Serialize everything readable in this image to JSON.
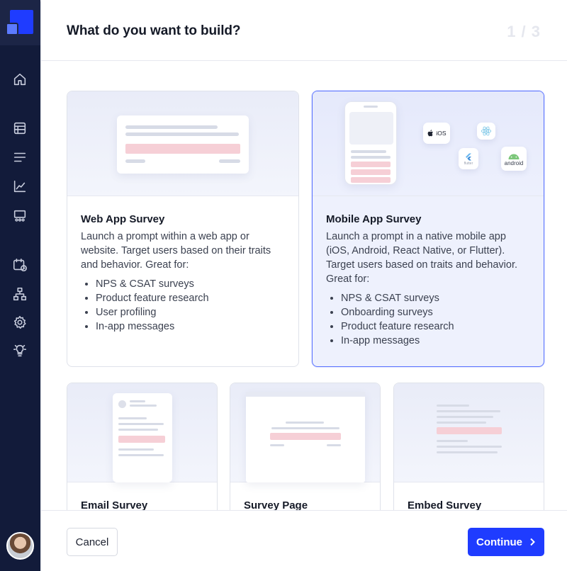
{
  "modal": {
    "title": "What do you want to build?",
    "step": "1 / 3"
  },
  "sidebar": {
    "icons": [
      "home-icon",
      "table-icon",
      "list-icon",
      "chart-icon",
      "presentation-icon",
      "calendar-clock-icon",
      "sitemap-icon",
      "gear-icon",
      "lightbulb-icon"
    ]
  },
  "cards": [
    {
      "title": "Web App Survey",
      "description": "Launch a prompt within a web app or website. Target users based on their traits and behavior. Great for:",
      "items": [
        "NPS & CSAT surveys",
        "Product feature research",
        "User profiling",
        "In-app messages"
      ],
      "selected": false
    },
    {
      "title": "Mobile App Survey",
      "description": "Launch a prompt in a native mobile app (iOS, Android, React Native, or Flutter). Target users based on traits and behavior. Great for:",
      "items": [
        "NPS & CSAT surveys",
        "Onboarding surveys",
        "Product feature research",
        "In-app messages"
      ],
      "selected": true,
      "platform_tiles": [
        "iOS",
        "android",
        "flutter"
      ]
    },
    {
      "title": "Email Survey"
    },
    {
      "title": "Survey Page"
    },
    {
      "title": "Embed Survey"
    }
  ],
  "footer": {
    "cancel_label": "Cancel",
    "continue_label": "Continue"
  },
  "colors": {
    "accent": "#1f3cff",
    "sidebar": "#121b3a",
    "selected_border": "#5a73ff"
  }
}
